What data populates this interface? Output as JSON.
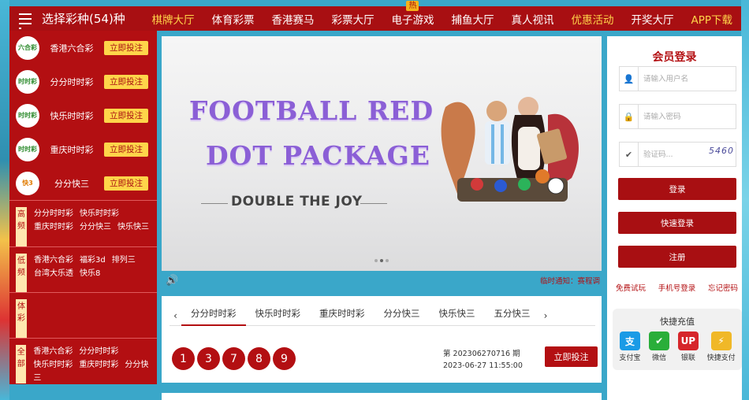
{
  "nav": {
    "brand": "选择彩种(54)种",
    "items": [
      {
        "label": "棋牌大厅",
        "gold": true
      },
      {
        "label": "体育彩票"
      },
      {
        "label": "香港赛马"
      },
      {
        "label": "彩票大厅"
      },
      {
        "label": "电子游戏",
        "badge": "热"
      },
      {
        "label": "捕鱼大厅"
      },
      {
        "label": "真人视讯"
      },
      {
        "label": "优惠活动",
        "gold": true
      },
      {
        "label": "开奖大厅"
      },
      {
        "label": "APP下载",
        "gold": true
      }
    ]
  },
  "sidebar": {
    "lotteries": [
      {
        "name": "香港六合彩",
        "logo": "六合彩",
        "button": "立即投注"
      },
      {
        "name": "分分时时彩",
        "logo": "时时彩",
        "button": "立即投注"
      },
      {
        "name": "快乐时时彩",
        "logo": "时时彩",
        "button": "立即投注"
      },
      {
        "name": "重庆时时彩",
        "logo": "时时彩",
        "button": "立即投注"
      },
      {
        "name": "分分快三",
        "logo": "快3",
        "button": "立即投注"
      }
    ],
    "categories": [
      {
        "tag": "高频",
        "games": [
          [
            "分分时时彩",
            "快乐时时彩"
          ],
          [
            "重庆时时彩",
            "分分快三",
            "快乐快三"
          ]
        ]
      },
      {
        "tag": "低频",
        "games": [
          [
            "香港六合彩",
            "福彩3d",
            "排列三"
          ],
          [
            "台湾大乐透",
            "快乐8"
          ]
        ]
      },
      {
        "tag": "体彩",
        "games": []
      },
      {
        "tag": "全部",
        "games": [
          [
            "香港六合彩",
            "分分时时彩"
          ],
          [
            "快乐时时彩",
            "重庆时时彩",
            "分分快三"
          ]
        ]
      }
    ]
  },
  "banner": {
    "line1": "FOOTBALL RED",
    "line2": "DOT PACKAGE",
    "tagline": "DOUBLE THE JOY"
  },
  "notice": {
    "text": "临时通知：赛程调"
  },
  "draw": {
    "tabs": [
      "分分时时彩",
      "快乐时时彩",
      "重庆时时彩",
      "分分快三",
      "快乐快三",
      "五分快三"
    ],
    "active_tab": 0,
    "numbers": [
      "1",
      "3",
      "7",
      "8",
      "9"
    ],
    "period": "第 202306270716 期",
    "time": "2023-06-27 11:55:00",
    "bet_button": "立即投注"
  },
  "login": {
    "title": "会员登录",
    "username_placeholder": "请输入用户名",
    "password_placeholder": "请输入密码",
    "captcha_placeholder": "验证码...",
    "captcha_image_text": "5460",
    "login_button": "登录",
    "quick_login_button": "快速登录",
    "register_button": "注册",
    "links": [
      "免费试玩",
      "手机号登录",
      "忘记密码"
    ],
    "recharge_title": "快捷充值",
    "payments": [
      {
        "label": "支付宝",
        "icon": "alipay-icon",
        "color": "#1a9be6",
        "glyph": "支"
      },
      {
        "label": "微信",
        "icon": "wechat-icon",
        "color": "#2aae3a",
        "glyph": "✔"
      },
      {
        "label": "银联",
        "icon": "unionpay-icon",
        "color": "#d6262b",
        "glyph": "UP"
      },
      {
        "label": "快捷支付",
        "icon": "quickpay-icon",
        "color": "#f0b828",
        "glyph": "⚡"
      }
    ]
  }
}
